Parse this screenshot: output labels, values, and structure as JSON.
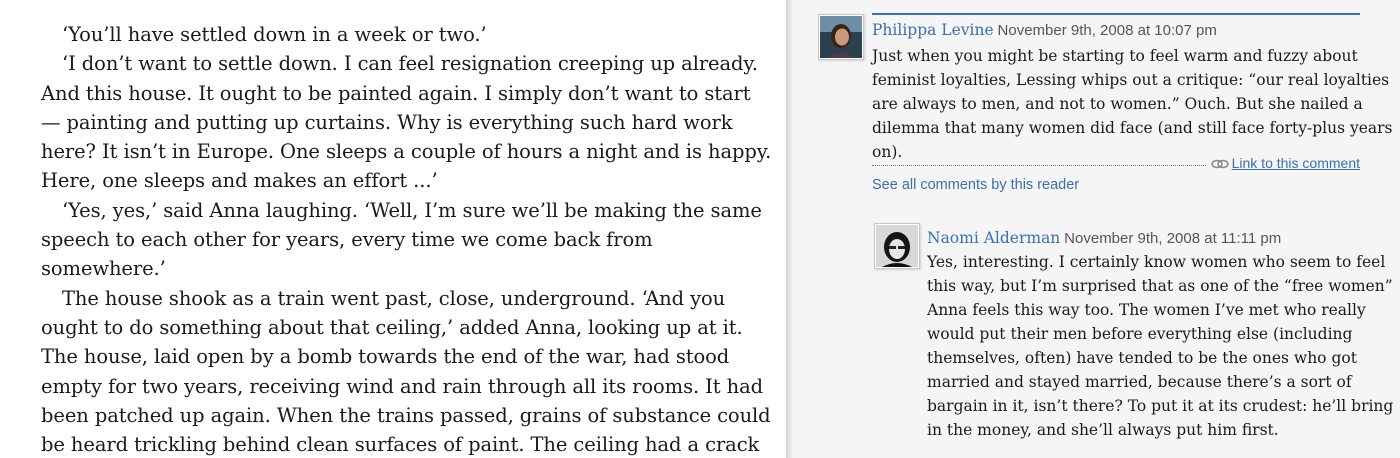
{
  "book": {
    "lines": [
      "‘You’ll have settled down in a week or two.’",
      "‘I don’t want to settle down. I can feel resignation creeping up already.",
      "And this house. It ought to be painted again. I simply don’t want to start",
      "— painting and putting up curtains. Why is everything such hard work",
      "here? It isn’t in Europe. One sleeps a couple of hours a night and is happy.",
      "Here, one sleeps and makes an effort ...’",
      "‘Yes, yes,’ said Anna laughing. ‘Well, I’m sure we’ll be making the same",
      "speech to each other for years, every time we come back from",
      "somewhere.’",
      "The house shook as a train went past, close, underground. ‘And you",
      "ought to do something about that ceiling,’ added Anna, looking up at it.",
      "The house, laid open by a bomb towards the end of the war, had stood",
      "empty for two years, receiving wind and rain through all its rooms. It had",
      "been patched up again. When the trains passed, grains of substance could",
      "be heard trickling behind clean surfaces of paint. The ceiling had a crack"
    ]
  },
  "comments": [
    {
      "author": "Philippa Levine",
      "date": "November 9th, 2008 at 10:07 pm",
      "lines": [
        "Just when you might be starting to feel warm and fuzzy about",
        "feminist loyalties, Lessing whips out a critique: “our real loyalties",
        "are always to men, and not to women.” Ouch. But she nailed a",
        "dilemma that many women did face (and still face forty-plus years",
        "on)."
      ],
      "link_label": "Link to this comment",
      "see_all_label": "See all comments by this reader"
    },
    {
      "author": "Naomi Alderman",
      "date": "November 9th, 2008 at 11:11 pm",
      "lines": [
        "Yes, interesting. I certainly know women who seem to feel",
        "this way, but I’m surprised that as one of the “free women”",
        "Anna feels this way too. The women I’ve met who really",
        "would put their men before everything else (including",
        "themselves, often) have tended to be the ones who got",
        "married and stayed married, because there’s a sort of",
        "bargain in it, isn’t there? To put it at its crudest: he’ll bring",
        "in the money, and she’ll always put him first."
      ]
    }
  ],
  "colors": {
    "link": "#3a6fb0",
    "panel_background": "#f5f5f5",
    "text": "#1a1a1a"
  }
}
